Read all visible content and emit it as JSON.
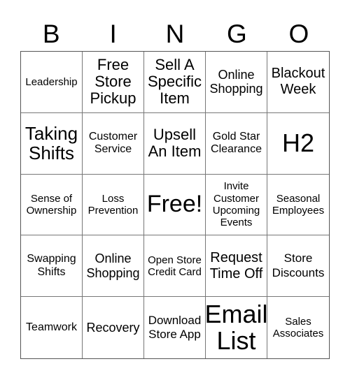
{
  "header": {
    "letters": [
      "B",
      "I",
      "N",
      "G",
      "O"
    ]
  },
  "cells": [
    {
      "text": "Leadership",
      "size": "s15"
    },
    {
      "text": "Free Store Pickup",
      "size": "s22"
    },
    {
      "text": "Sell A Specific Item",
      "size": "s22"
    },
    {
      "text": "Online Shopping",
      "size": "s18"
    },
    {
      "text": "Blackout Week",
      "size": "s20"
    },
    {
      "text": "Taking Shifts",
      "size": "s26"
    },
    {
      "text": "Customer Service",
      "size": "s16"
    },
    {
      "text": "Upsell An Item",
      "size": "s22"
    },
    {
      "text": "Gold Star Clearance",
      "size": "s16"
    },
    {
      "text": "H2",
      "size": "s36"
    },
    {
      "text": "Sense of Ownership",
      "size": "s15"
    },
    {
      "text": "Loss Prevention",
      "size": "s15"
    },
    {
      "text": "Free!",
      "size": "s34"
    },
    {
      "text": "Invite Customer Upcoming Events",
      "size": "s15"
    },
    {
      "text": "Seasonal Employees",
      "size": "s15"
    },
    {
      "text": "Swapping Shifts",
      "size": "s16"
    },
    {
      "text": "Online Shopping",
      "size": "s18"
    },
    {
      "text": "Open Store Credit Card",
      "size": "s15"
    },
    {
      "text": "Request Time Off",
      "size": "s20"
    },
    {
      "text": "Store Discounts",
      "size": "s17"
    },
    {
      "text": "Teamwork",
      "size": "s16"
    },
    {
      "text": "Recovery",
      "size": "s18"
    },
    {
      "text": "Download Store App",
      "size": "s17"
    },
    {
      "text": "Email List",
      "size": "s36"
    },
    {
      "text": "Sales Associates",
      "size": "s15"
    }
  ]
}
